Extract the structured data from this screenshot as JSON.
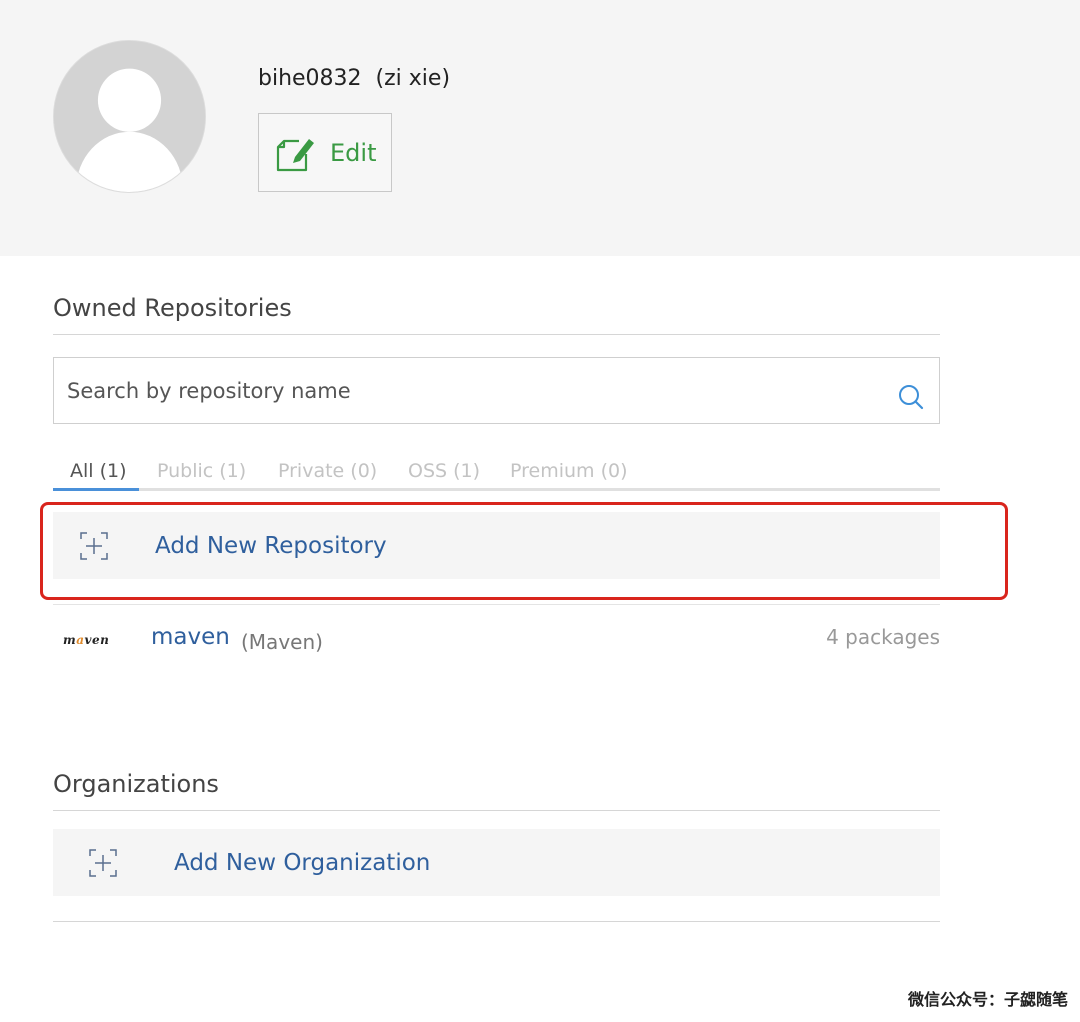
{
  "profile": {
    "username": "bihe0832",
    "display_name": "(zi xie)",
    "edit_label": "Edit"
  },
  "owned_repositories": {
    "title": "Owned Repositories",
    "search_placeholder": "Search by repository name",
    "tabs": [
      {
        "label": "All (1)",
        "active": true
      },
      {
        "label": "Public (1)",
        "active": false
      },
      {
        "label": "Private (0)",
        "active": false
      },
      {
        "label": "OSS (1)",
        "active": false
      },
      {
        "label": "Premium (0)",
        "active": false
      }
    ],
    "add_label": "Add New Repository",
    "repositories": [
      {
        "logo_text": "maven",
        "name": "maven",
        "type": "(Maven)",
        "count": "4 packages"
      }
    ]
  },
  "organizations": {
    "title": "Organizations",
    "add_label": "Add New Organization"
  },
  "watermark": "微信公众号：子勰随笔",
  "colors": {
    "link": "#2f5f9d",
    "edit_green": "#3a9a43",
    "highlight_red": "#d9251d",
    "tab_accent": "#4a90d9"
  }
}
